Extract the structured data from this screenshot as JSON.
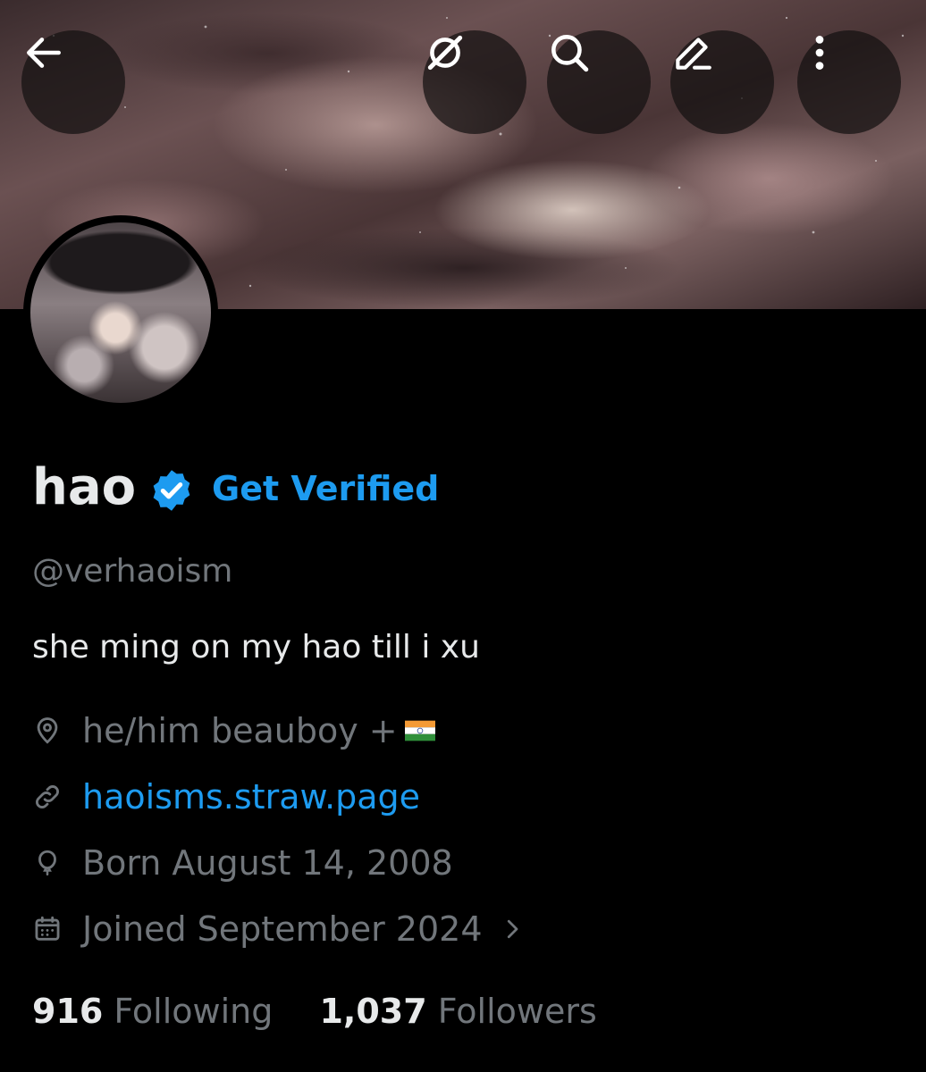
{
  "header": {
    "back_icon": "back-arrow-icon",
    "actions": [
      "grok-icon",
      "search-icon",
      "edit-icon",
      "more-vertical-icon"
    ]
  },
  "profile": {
    "display_name": "hao",
    "verified_badge": "verified-badge-icon",
    "get_verified_label": "Get Verified",
    "handle": "@verhaoism",
    "bio": "she ming on my hao till i xu",
    "location": "he/him beauboy +",
    "location_emoji": "india-flag",
    "website": "haoisms.straw.page",
    "birth": "Born August 14, 2008",
    "joined": "Joined September 2024",
    "following_count": "916",
    "following_label": "Following",
    "followers_count": "1,037",
    "followers_label": "Followers"
  },
  "colors": {
    "background": "#000000",
    "primary_text": "#e7e9ea",
    "secondary_text": "#71767b",
    "accent": "#1d9bf0"
  }
}
